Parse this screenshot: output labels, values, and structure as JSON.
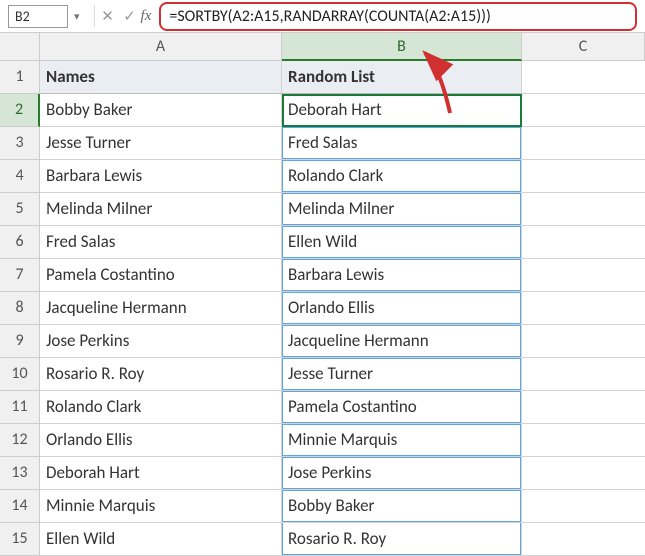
{
  "name_box": "B2",
  "fx_label": "fx",
  "formula": "=SORTBY(A2:A15,RANDARRAY(COUNTA(A2:A15)))",
  "columns": [
    "A",
    "B",
    "C"
  ],
  "active_column": "B",
  "active_row": 2,
  "headers": {
    "a": "Names",
    "b": "Random List"
  },
  "rows": [
    {
      "n": 1,
      "a": "Names",
      "b": "Random List",
      "header": true
    },
    {
      "n": 2,
      "a": "Bobby Baker",
      "b": "Deborah Hart"
    },
    {
      "n": 3,
      "a": "Jesse Turner",
      "b": "Fred Salas"
    },
    {
      "n": 4,
      "a": "Barbara Lewis",
      "b": "Rolando Clark"
    },
    {
      "n": 5,
      "a": "Melinda Milner",
      "b": "Melinda Milner"
    },
    {
      "n": 6,
      "a": "Fred Salas",
      "b": "Ellen Wild"
    },
    {
      "n": 7,
      "a": "Pamela Costantino",
      "b": "Barbara Lewis"
    },
    {
      "n": 8,
      "a": "Jacqueline Hermann",
      "b": "Orlando Ellis"
    },
    {
      "n": 9,
      "a": "Jose Perkins",
      "b": "Jacqueline Hermann"
    },
    {
      "n": 10,
      "a": "Rosario R. Roy",
      "b": "Jesse Turner"
    },
    {
      "n": 11,
      "a": "Rolando Clark",
      "b": "Pamela Costantino"
    },
    {
      "n": 12,
      "a": "Orlando Ellis",
      "b": "Minnie Marquis"
    },
    {
      "n": 13,
      "a": "Deborah Hart",
      "b": "Jose Perkins"
    },
    {
      "n": 14,
      "a": "Minnie Marquis",
      "b": "Bobby Baker"
    },
    {
      "n": 15,
      "a": "Ellen Wild",
      "b": "Rosario R. Roy"
    }
  ]
}
